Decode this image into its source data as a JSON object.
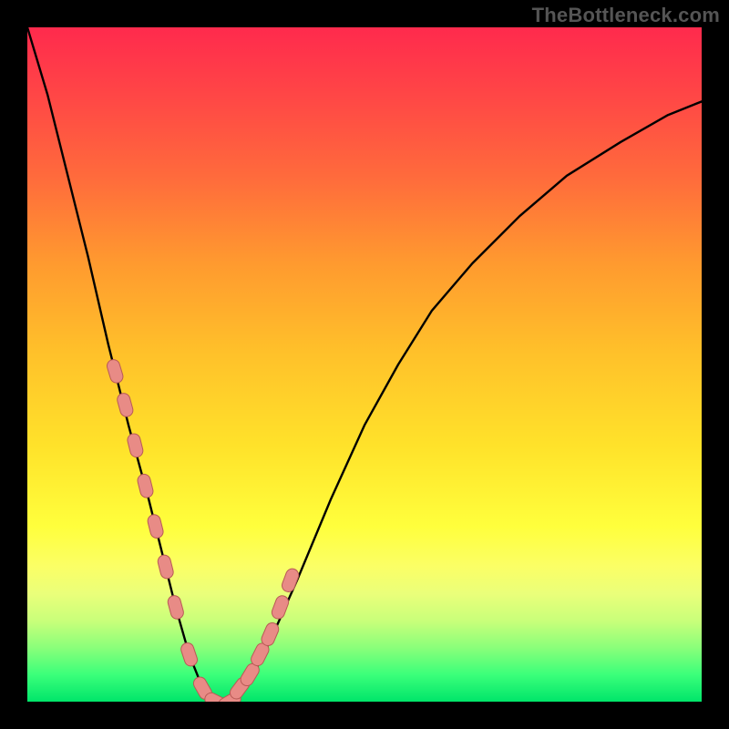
{
  "attribution": "TheBottleneck.com",
  "colors": {
    "frame": "#000000",
    "curve_stroke": "#000000",
    "marker_fill": "#e88b86",
    "marker_stroke": "#b85a55",
    "gradient_stops": [
      "#ff2a4d",
      "#ff4646",
      "#ff6a3c",
      "#ff9a2f",
      "#ffc02a",
      "#ffe22a",
      "#ffff3c",
      "#fbff66",
      "#eaff7a",
      "#c9ff7a",
      "#8aff7a",
      "#3bff7a",
      "#00e56a"
    ]
  },
  "chart_data": {
    "type": "line",
    "title": "",
    "xlabel": "",
    "ylabel": "",
    "xlim": [
      0,
      100
    ],
    "ylim": [
      0,
      100
    ],
    "grid": false,
    "series": [
      {
        "name": "bottleneck-curve",
        "x": [
          0,
          3,
          6,
          9,
          12,
          15,
          18,
          20,
          22,
          24,
          26,
          28,
          30,
          33,
          36,
          40,
          45,
          50,
          55,
          60,
          66,
          73,
          80,
          88,
          95,
          100
        ],
        "y": [
          100,
          90,
          78,
          66,
          53,
          41,
          30,
          22,
          14,
          7,
          2,
          0,
          0,
          3,
          9,
          18,
          30,
          41,
          50,
          58,
          65,
          72,
          78,
          83,
          87,
          89
        ]
      }
    ],
    "markers": {
      "name": "highlighted-points",
      "x": [
        13,
        14.5,
        16,
        17.5,
        19,
        20.5,
        22,
        24,
        26,
        28,
        30,
        31.5,
        33,
        34.5,
        36,
        37.5,
        39
      ],
      "y": [
        49,
        44,
        38,
        32,
        26,
        20,
        14,
        7,
        2,
        0,
        0,
        2,
        4,
        7,
        10,
        14,
        18
      ]
    }
  }
}
